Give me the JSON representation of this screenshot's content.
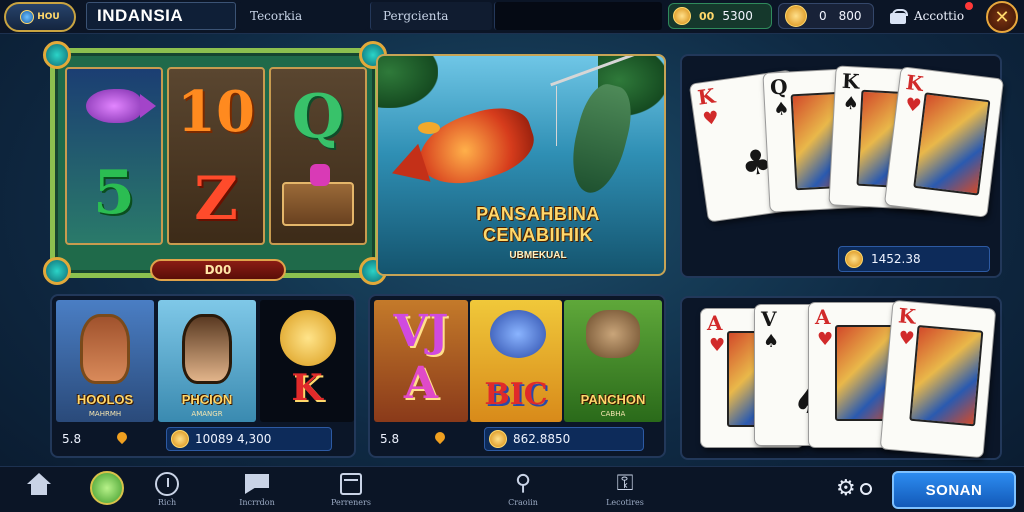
{
  "topbar": {
    "logo_text": "HOU",
    "brand_title": "INDANSIA",
    "tabs": [
      {
        "label": "Tecorkia"
      },
      {
        "label": "Pergcienta"
      },
      {
        "label": ""
      }
    ],
    "coin_balance_1": {
      "icon": "coin-icon",
      "prefix": "00",
      "value": "5300"
    },
    "coin_balance_2": {
      "icon": "coin-icon",
      "prefix": "0",
      "value": "800"
    },
    "account_label": "Accottio",
    "close_icon": "close-icon"
  },
  "featured_slot": {
    "reels": [
      {
        "symbols": [
          "fish",
          "5"
        ]
      },
      {
        "symbols": [
          "10",
          "Z"
        ]
      },
      {
        "symbols": [
          "Q",
          "chest"
        ]
      }
    ],
    "spin_label": "D00"
  },
  "fish_banner": {
    "title_line1": "PANSAHBINA",
    "title_line2": "CENABIIHIK",
    "subtitle": "UBMEKUAL"
  },
  "card_panel_1": {
    "cards": [
      {
        "rank": "K",
        "suit": "♥",
        "color": "red"
      },
      {
        "rank": "Q",
        "suit": "♠",
        "color": "black"
      },
      {
        "rank": "K",
        "suit": "♠",
        "color": "black"
      },
      {
        "rank": "K",
        "suit": "♥",
        "color": "red"
      }
    ],
    "balance": "1452.38"
  },
  "card_panel_2": {
    "cards": [
      {
        "rank": "A",
        "suit": "♥",
        "color": "red"
      },
      {
        "rank": "V",
        "suit": "♠",
        "color": "black"
      },
      {
        "rank": "A",
        "suit": "♥",
        "color": "red"
      },
      {
        "rank": "K",
        "suit": "♥",
        "color": "red"
      }
    ]
  },
  "game_group_1": {
    "thumbs": [
      {
        "title": "HOOLOS",
        "sub": "MAHRMH"
      },
      {
        "title": "PHCION",
        "sub": "AMANGR"
      },
      {
        "title": "K",
        "sub": ""
      }
    ],
    "footer_left": "5.8",
    "balance": "10089 4,300"
  },
  "game_group_2": {
    "thumbs": [
      {
        "title": "A",
        "sub": ""
      },
      {
        "title": "BIC",
        "sub": ""
      },
      {
        "title": "PANCHON",
        "sub": "CABHA"
      }
    ],
    "footer_left": "5.8",
    "balance": "862.8850"
  },
  "bottom_nav": {
    "items": [
      {
        "label": "",
        "icon": "home-icon"
      },
      {
        "label": "",
        "icon": "ball-icon"
      },
      {
        "label": "Rich",
        "icon": "clock-icon"
      },
      {
        "label": "Incrrdon",
        "icon": "flag-icon"
      },
      {
        "label": "Perreners",
        "icon": "box-icon"
      },
      {
        "label": "Craoiin",
        "icon": "bag-icon"
      },
      {
        "label": "Lecotires",
        "icon": "lock-icon"
      }
    ],
    "submit_label": "SONAN"
  },
  "colors": {
    "accent": "#2d8cf0",
    "gold": "#ffd86b",
    "panel_bg": "#0b1628"
  }
}
